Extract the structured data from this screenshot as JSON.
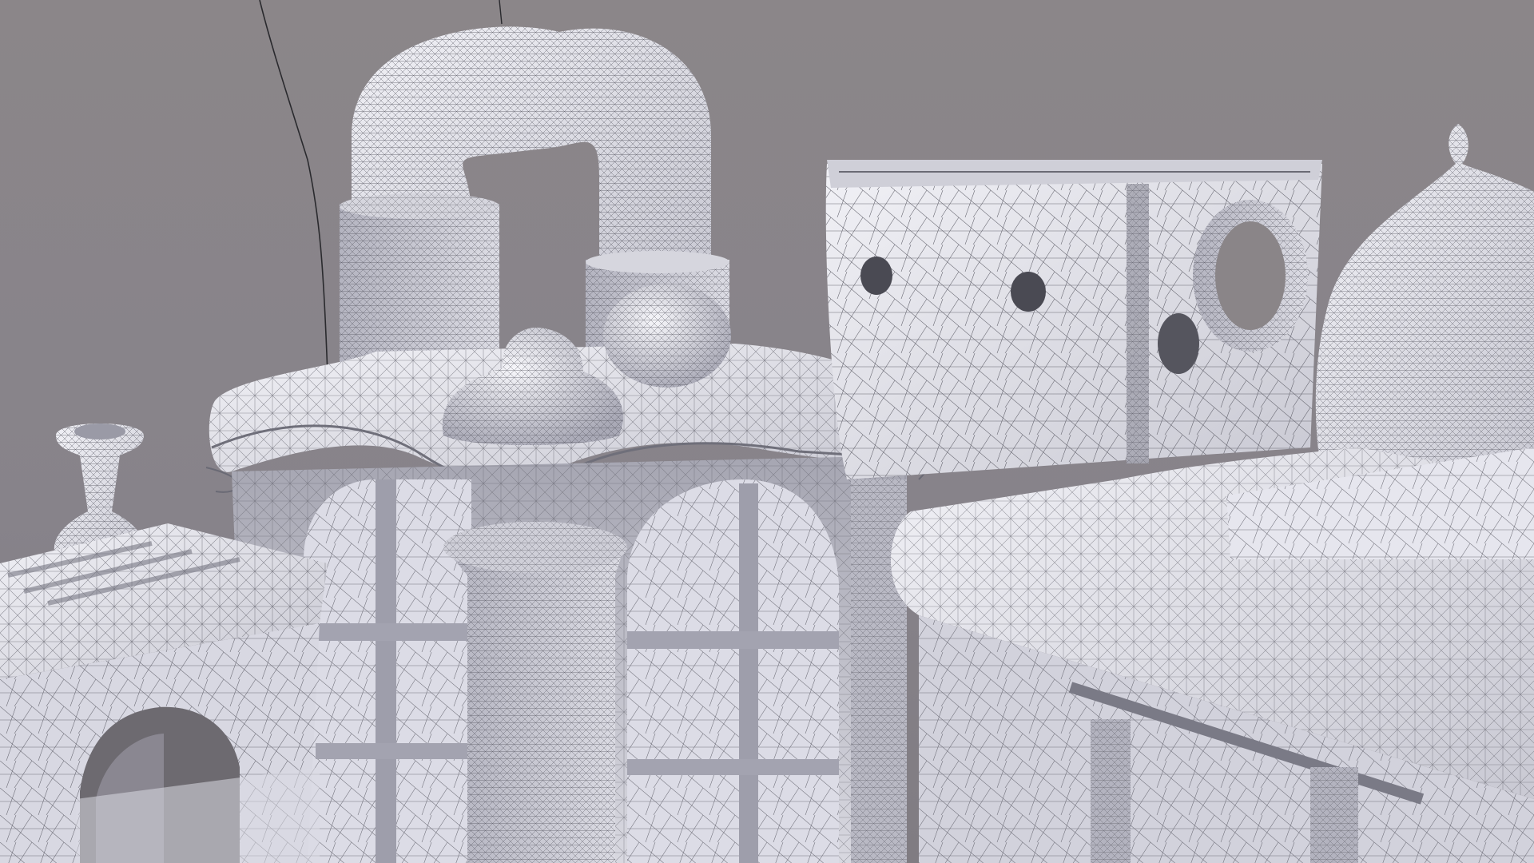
{
  "viewport": {
    "title": "",
    "background_color": "#8a8588",
    "mesh_surface_color": "#e4e4ec",
    "wire_color": "#55555e",
    "display_mode": "wireframe-over-solid"
  },
  "scene": {
    "objects": [
      "pipe-elbow",
      "pipe-base-left",
      "pipe-base-right",
      "dome-small-ornament",
      "sphere-ornament",
      "tower-top-slab",
      "arched-window-left",
      "arched-window-right",
      "central-column",
      "hollow-box",
      "ring-ornament",
      "onion-dome",
      "vase-finial",
      "left-bridge-arch",
      "right-terrace"
    ],
    "curve_count": 2
  }
}
